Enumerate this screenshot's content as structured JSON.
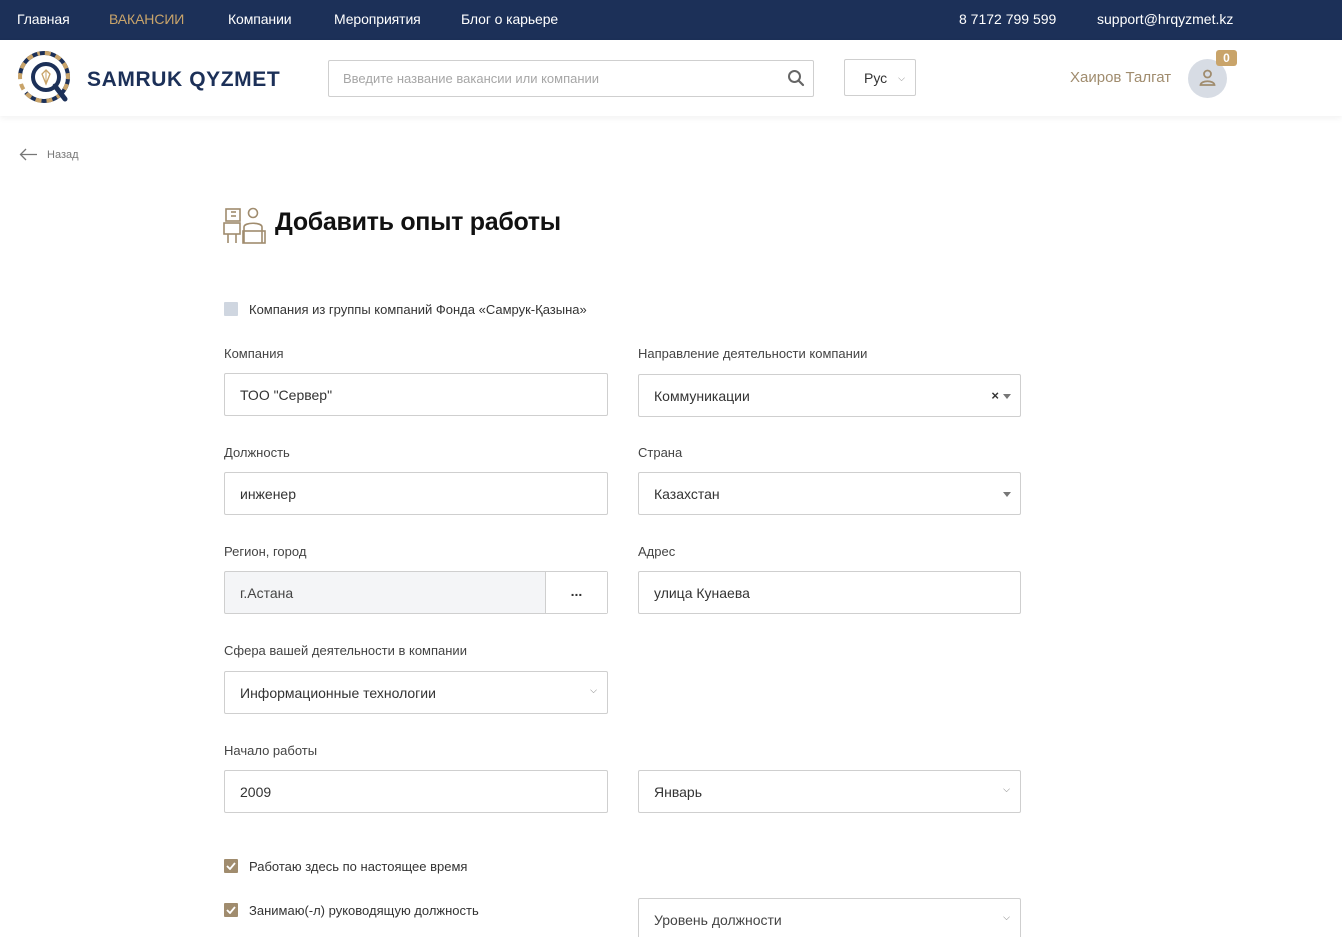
{
  "topnav": {
    "items": [
      "Главная",
      "ВАКАНСИИ",
      "Компании",
      "Мероприятия",
      "Блог о карьере"
    ],
    "active_index": 1,
    "phone": "8 7172 799 599",
    "email": "support@hrqyzmet.kz"
  },
  "header": {
    "logo_text": "SAMRUK QYZMET",
    "search_placeholder": "Введите название вакансии или компании",
    "language": "Рус",
    "user_name": "Хаиров Талгат",
    "notifications_count": "0"
  },
  "back_label": "Назад",
  "page_title": "Добавить опыт работы",
  "form": {
    "group_company_checkbox": {
      "label": "Компания из группы компаний Фонда «Самрук-Қазына»",
      "checked": false
    },
    "company": {
      "label": "Компания",
      "value": "ТОО \"Сервер\""
    },
    "direction": {
      "label": "Направление деятельности компании",
      "value": "Коммуникации",
      "clear": "×"
    },
    "position": {
      "label": "Должность",
      "value": "инженер"
    },
    "country": {
      "label": "Страна",
      "value": "Казахстан"
    },
    "region": {
      "label": "Регион, город",
      "value": "г.Астана",
      "button": "..."
    },
    "address": {
      "label": "Адрес",
      "value": "улица Кунаева"
    },
    "sphere": {
      "label": "Сфера вашей деятельности в компании",
      "value": "Информационные технологии"
    },
    "start": {
      "label": "Начало работы",
      "year": "2009",
      "month": "Январь"
    },
    "current_job_checkbox": {
      "label": "Работаю здесь по настоящее время",
      "checked": true
    },
    "manager_checkbox": {
      "label": "Занимаю(-л) руководящую должность",
      "checked": true
    },
    "position_level": {
      "placeholder": "Уровень должности"
    }
  },
  "colors": {
    "navy": "#1c3058",
    "gold": "#c9a46a",
    "brown": "#a08c6e"
  }
}
